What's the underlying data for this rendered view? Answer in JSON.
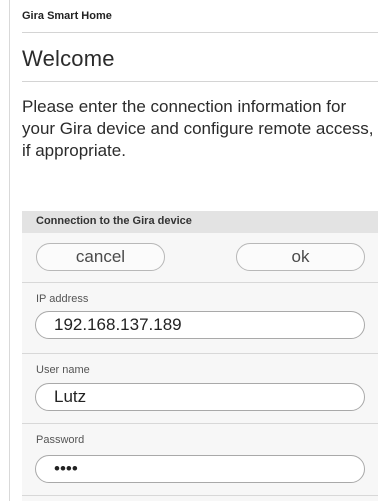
{
  "app": {
    "title": "Gira Smart Home"
  },
  "page": {
    "heading": "Welcome",
    "intro": "Please enter the connection information for your Gira device and configure remote access, if appropriate."
  },
  "connection": {
    "section_title": "Connection to the Gira device",
    "cancel_label": "cancel",
    "ok_label": "ok",
    "ip": {
      "label": "IP address",
      "value": "192.168.137.189"
    },
    "user": {
      "label": "User name",
      "value": "Lutz"
    },
    "password": {
      "label": "Password",
      "value": "••••"
    }
  },
  "colors": {
    "section_band": "#e3e3e3",
    "section_body": "#f7f7f7",
    "text": "#2b2b2b"
  }
}
